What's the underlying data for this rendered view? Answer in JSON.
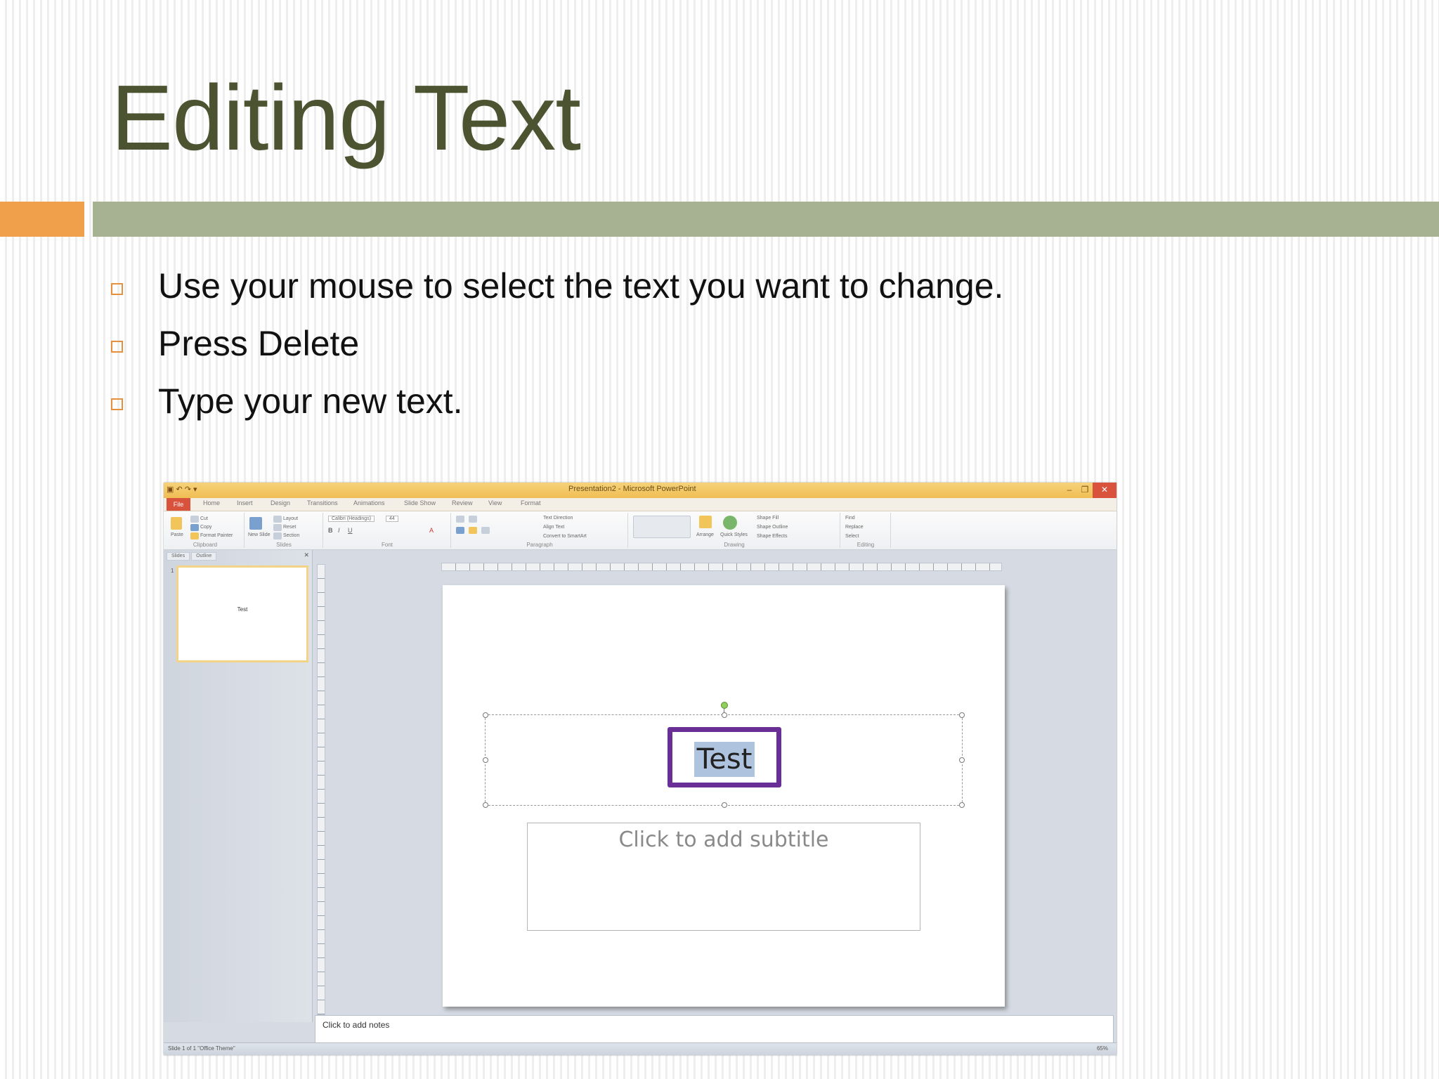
{
  "slide": {
    "title": "Editing Text",
    "bullets": [
      "Use your mouse to select the text you want to change.",
      "Press Delete",
      "Type your new text."
    ],
    "colors": {
      "title": "#4b5330",
      "accent_orange": "#f0a04a",
      "accent_green": "#a7b292",
      "highlight_box": "#6a2e97"
    }
  },
  "screenshot": {
    "window_title": "Presentation2 - Microsoft PowerPoint",
    "file_tab": "File",
    "tabs": [
      "Home",
      "Insert",
      "Design",
      "Transitions",
      "Animations",
      "Slide Show",
      "Review",
      "View",
      "Format"
    ],
    "ribbon_groups": [
      "Clipboard",
      "Slides",
      "Font",
      "Paragraph",
      "Drawing",
      "Editing"
    ],
    "ribbon_items": {
      "paste": "Paste",
      "cut": "Cut",
      "copy": "Copy",
      "format_painter": "Format Painter",
      "new_slide": "New Slide",
      "layout": "Layout",
      "reset": "Reset",
      "section": "Section",
      "font_name": "Calibri (Headings)",
      "font_size": "44",
      "text_direction": "Text Direction",
      "align_text": "Align Text",
      "convert_smartart": "Convert to SmartArt",
      "arrange": "Arrange",
      "quick_styles": "Quick Styles",
      "shape_fill": "Shape Fill",
      "shape_outline": "Shape Outline",
      "shape_effects": "Shape Effects",
      "find": "Find",
      "replace": "Replace",
      "select": "Select"
    },
    "pane_tabs": [
      "Slides",
      "Outline"
    ],
    "thumbnail_number": "1",
    "thumbnail_text": "Test",
    "selected_text": "Test",
    "subtitle_placeholder": "Click to add subtitle",
    "notes_placeholder": "Click to add notes",
    "status_left": "Slide 1 of 1    \"Office Theme\"",
    "zoom": "65%"
  }
}
